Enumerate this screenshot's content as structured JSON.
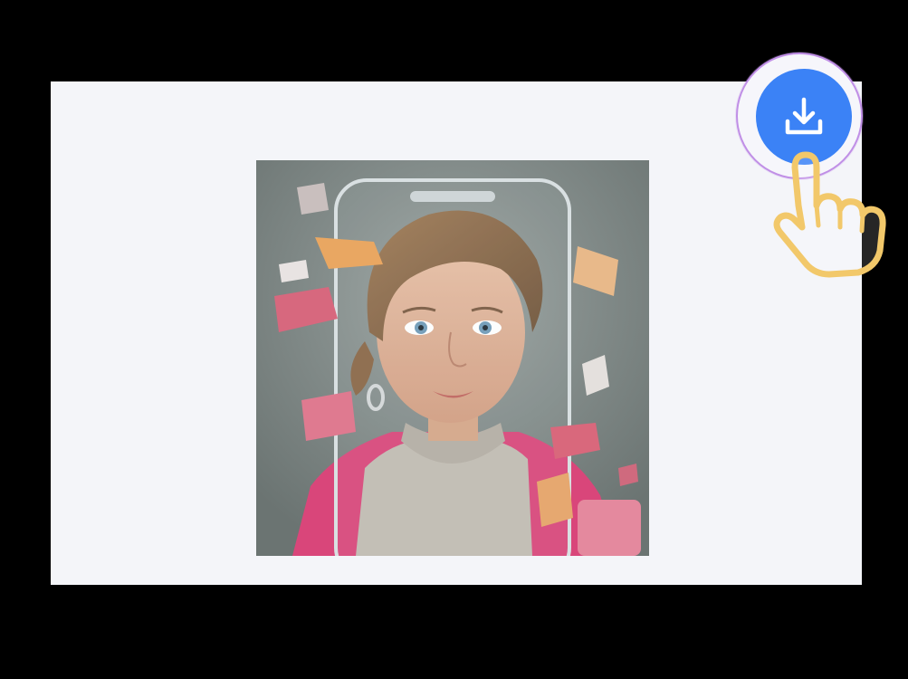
{
  "colors": {
    "backdrop": "#000000",
    "panel": "#f4f5f9",
    "download_button": "#3b82f6",
    "ring_border": "#c08fe6",
    "hand_outline": "#f2c86a"
  },
  "image": {
    "alt": "",
    "subject_icon": "portrait-image"
  },
  "download": {
    "icon": "download-icon"
  },
  "cursor": {
    "icon": "pointer-hand-icon"
  }
}
